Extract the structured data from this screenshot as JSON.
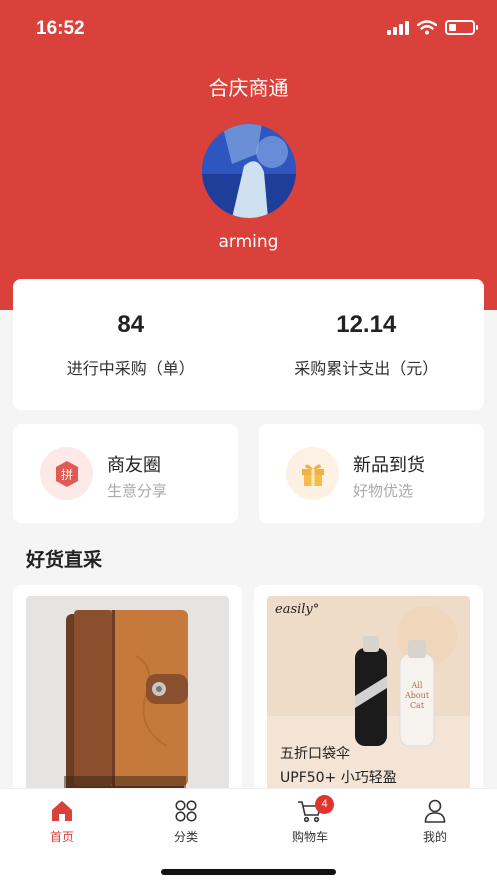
{
  "status_bar": {
    "time": "16:52"
  },
  "header": {
    "title": "合庆商通",
    "username": "arming"
  },
  "stats": [
    {
      "value": "84",
      "label": "进行中采购（单）"
    },
    {
      "value": "12.14",
      "label": "采购累计支出（元）"
    }
  ],
  "features": [
    {
      "title": "商友圈",
      "subtitle": "生意分享",
      "icon": "pin-badge-icon",
      "icon_bg": "#fde9e8"
    },
    {
      "title": "新品到货",
      "subtitle": "好物优选",
      "icon": "gift-icon",
      "icon_bg": "#fdf1e3"
    }
  ],
  "section": {
    "title": "好货直采"
  },
  "products": [
    {
      "image": "brown-notebook"
    },
    {
      "brand": "easily°",
      "promo_line1": "五折口袋伞",
      "promo_line2": "UPF50+ 小巧轻盈"
    }
  ],
  "tabbar": {
    "items": [
      {
        "label": "首页",
        "icon": "home-icon",
        "active": true
      },
      {
        "label": "分类",
        "icon": "category-icon",
        "active": false
      },
      {
        "label": "购物车",
        "icon": "cart-icon",
        "active": false,
        "badge": "4"
      },
      {
        "label": "我的",
        "icon": "user-icon",
        "active": false
      }
    ]
  },
  "colors": {
    "primary": "#d9413a",
    "badge": "#e0352d"
  }
}
